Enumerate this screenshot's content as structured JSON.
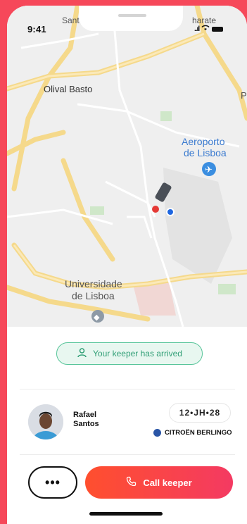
{
  "status_bar": {
    "time": "9:41",
    "signal": "..ıl"
  },
  "map": {
    "labels": {
      "top_left": "Santo",
      "top_right": "harate",
      "olival": "Olival Basto",
      "p": "P",
      "airport_line1": "Aeroporto",
      "airport_line2": "de Lisboa",
      "univ_line1": "Universidade",
      "univ_line2": "de Lisboa"
    }
  },
  "status_pill": {
    "text": "Your keeper has arrived"
  },
  "keeper": {
    "first_name": "Rafael",
    "last_name": "Santos"
  },
  "vehicle": {
    "plate": "12•JH•28",
    "model": "CITROËN BERLINGO"
  },
  "actions": {
    "more": "•••",
    "call": "Call keeper"
  },
  "colors": {
    "accent": "#f6485a",
    "success": "#58c59a",
    "vehicle_dot": "#2a55a6"
  }
}
